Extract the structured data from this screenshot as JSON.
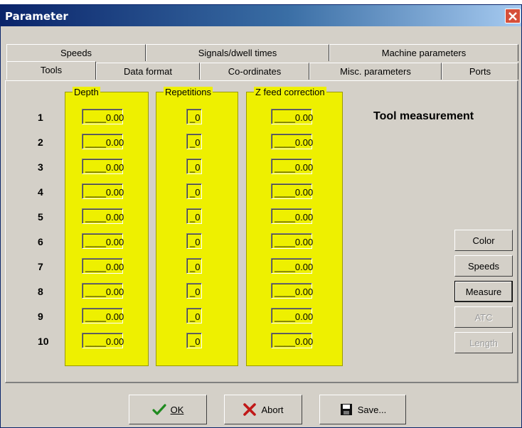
{
  "window": {
    "title": "Parameter"
  },
  "tabs_row1": [
    {
      "label": "Speeds"
    },
    {
      "label": "Signals/dwell times"
    },
    {
      "label": "Machine parameters"
    }
  ],
  "tabs_row2": [
    {
      "label": "Tools"
    },
    {
      "label": "Data format"
    },
    {
      "label": "Co-ordinates"
    },
    {
      "label": "Misc. parameters"
    },
    {
      "label": "Ports"
    }
  ],
  "groups": {
    "depth": "Depth",
    "repetitions": "Repetitions",
    "zfeed": "Z feed correction"
  },
  "rows": [
    {
      "num": "1",
      "depth": "____0.00",
      "rep": "_0",
      "zfeed": "____0.00"
    },
    {
      "num": "2",
      "depth": "____0.00",
      "rep": "_0",
      "zfeed": "____0.00"
    },
    {
      "num": "3",
      "depth": "____0.00",
      "rep": "_0",
      "zfeed": "____0.00"
    },
    {
      "num": "4",
      "depth": "____0.00",
      "rep": "_0",
      "zfeed": "____0.00"
    },
    {
      "num": "5",
      "depth": "____0.00",
      "rep": "_0",
      "zfeed": "____0.00"
    },
    {
      "num": "6",
      "depth": "____0.00",
      "rep": "_0",
      "zfeed": "____0.00"
    },
    {
      "num": "7",
      "depth": "____0.00",
      "rep": "_0",
      "zfeed": "____0.00"
    },
    {
      "num": "8",
      "depth": "____0.00",
      "rep": "_0",
      "zfeed": "____0.00"
    },
    {
      "num": "9",
      "depth": "____0.00",
      "rep": "_0",
      "zfeed": "____0.00"
    },
    {
      "num": "10",
      "depth": "____0.00",
      "rep": "_0",
      "zfeed": "____0.00"
    }
  ],
  "side": {
    "title": "Tool measurement",
    "color": "Color",
    "speeds": "Speeds",
    "measure": "Measure",
    "atc": "ATC",
    "length": "Length"
  },
  "footer": {
    "ok": "OK",
    "abort": "Abort",
    "save": "Save..."
  },
  "colors": {
    "highlight": "#eef000",
    "face": "#d4d0c8"
  }
}
